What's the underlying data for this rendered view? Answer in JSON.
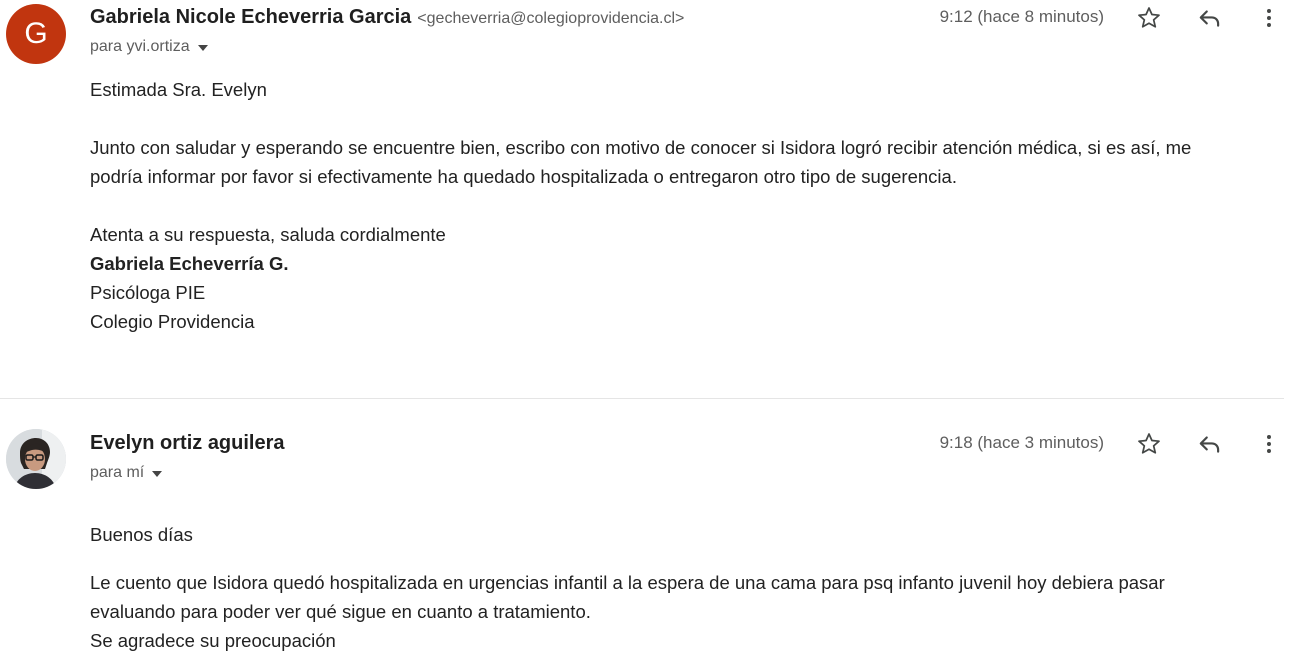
{
  "messages": [
    {
      "avatar_letter": "G",
      "avatar_color": "#c1350f",
      "sender_name": "Gabriela Nicole Echeverria Garcia",
      "sender_email": "<gecheverria@colegioprovidencia.cl>",
      "recipient": "para yvi.ortiza",
      "time": "9:12 (hace 8 minutos)",
      "body": {
        "greeting": "Estimada Sra. Evelyn",
        "paragraph_line1": "Junto con saludar y esperando se encuentre bien, escribo con motivo de conocer si Isidora logró recibir atención médica, si es así, me",
        "paragraph_line2": "podría informar por favor si efectivamente ha quedado hospitalizada o entregaron otro tipo de sugerencia.",
        "closing": "Atenta a su respuesta, saluda cordialmente",
        "signature_name": "Gabriela Echeverría G.",
        "signature_role": "Psicóloga PIE",
        "signature_org": "Colegio Providencia"
      }
    },
    {
      "avatar_icon": "profile-photo",
      "sender_name": "Evelyn ortiz aguilera",
      "recipient": "para mí",
      "time": "9:18 (hace 3 minutos)",
      "body": {
        "greeting": "Buenos días",
        "line1": "Le cuento que Isidora quedó hospitalizada en urgencias infantil a la espera de una cama para psq infanto juvenil hoy debiera pasar",
        "line2": "evaluando para poder ver qué sigue en cuanto a tratamiento.",
        "line3": "Se agradece su preocupación"
      }
    }
  ],
  "icons": {
    "star": "star-outline-icon",
    "reply": "reply-icon",
    "more": "more-vert-icon",
    "caret": "caret-down-icon"
  }
}
